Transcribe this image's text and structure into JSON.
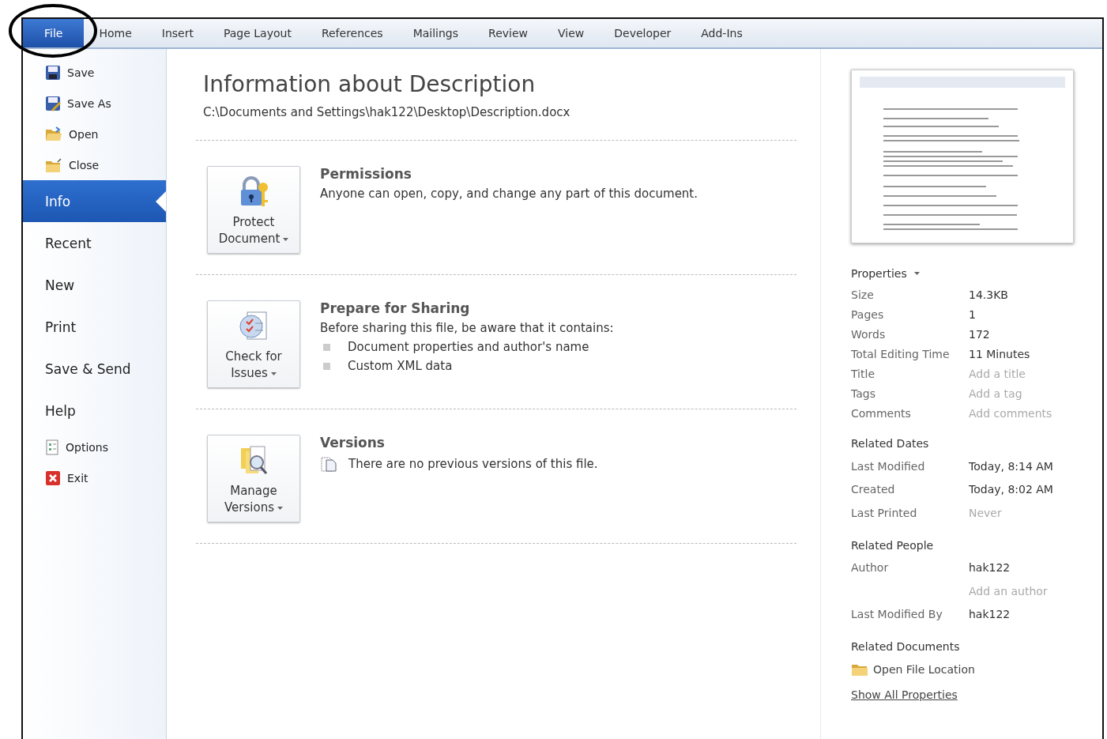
{
  "ribbon_tabs": [
    {
      "label": "File",
      "selected": true
    },
    {
      "label": "Home",
      "selected": false
    },
    {
      "label": "Insert",
      "selected": false
    },
    {
      "label": "Page Layout",
      "selected": false
    },
    {
      "label": "References",
      "selected": false
    },
    {
      "label": "Mailings",
      "selected": false
    },
    {
      "label": "Review",
      "selected": false
    },
    {
      "label": "View",
      "selected": false
    },
    {
      "label": "Developer",
      "selected": false
    },
    {
      "label": "Add-Ins",
      "selected": false
    }
  ],
  "nav": {
    "items": [
      {
        "kind": "command",
        "label": "Save",
        "selected": false
      },
      {
        "kind": "command",
        "label": "Save As",
        "selected": false
      },
      {
        "kind": "command",
        "label": "Open",
        "selected": false
      },
      {
        "kind": "command",
        "label": "Close",
        "selected": false
      },
      {
        "kind": "page",
        "label": "Info",
        "selected": true
      },
      {
        "kind": "page",
        "label": "Recent",
        "selected": false
      },
      {
        "kind": "page",
        "label": "New",
        "selected": false
      },
      {
        "kind": "page",
        "label": "Print",
        "selected": false
      },
      {
        "kind": "page",
        "label": "Save & Send",
        "selected": false
      },
      {
        "kind": "page",
        "label": "Help",
        "selected": false
      },
      {
        "kind": "command",
        "label": "Options",
        "selected": false
      },
      {
        "kind": "command",
        "label": "Exit",
        "selected": false
      }
    ]
  },
  "info": {
    "title": "Information about Description",
    "path": "C:\\Documents and Settings\\hak122\\Desktop\\Description.docx",
    "sections": [
      {
        "kind": "permissions",
        "button": "Protect Document",
        "heading": "Permissions",
        "description": "Anyone can open, copy, and change any part of this document."
      },
      {
        "kind": "sharing",
        "button": "Check for Issues",
        "heading": "Prepare for Sharing",
        "description": "Before sharing this file, be aware that it contains:",
        "bullets": [
          "Document properties and author's name",
          "Custom XML data"
        ]
      },
      {
        "kind": "versions",
        "button": "Manage Versions",
        "heading": "Versions",
        "notes": [
          "There are no previous versions of this file."
        ]
      }
    ]
  },
  "properties": {
    "heading": "Properties",
    "rows": [
      {
        "label": "Size",
        "value": "14.3KB"
      },
      {
        "label": "Pages",
        "value": "1"
      },
      {
        "label": "Words",
        "value": "172"
      },
      {
        "label": "Total Editing Time",
        "value": "11 Minutes"
      },
      {
        "label": "Title",
        "placeholder": "Add a title"
      },
      {
        "label": "Tags",
        "placeholder": "Add a tag"
      },
      {
        "label": "Comments",
        "placeholder": "Add comments"
      }
    ],
    "groups": [
      {
        "heading": "Related Dates",
        "rows": [
          {
            "label": "Last Modified",
            "value": "Today, 8:14 AM",
            "dimmed": false
          },
          {
            "label": "Created",
            "value": "Today, 8:02 AM",
            "dimmed": false
          },
          {
            "label": "Last Printed",
            "value": "Never",
            "dimmed": true
          }
        ]
      },
      {
        "heading": "Related People",
        "rows": [
          {
            "label": "Author",
            "value": "hak122",
            "dimmed": false
          },
          {
            "placeholder": "Add an author"
          },
          {
            "label": "Last Modified By",
            "value": "hak122",
            "dimmed": false
          }
        ]
      }
    ],
    "related_documents": {
      "heading": "Related Documents",
      "link": "Open File Location"
    },
    "show_all": "Show All Properties"
  }
}
